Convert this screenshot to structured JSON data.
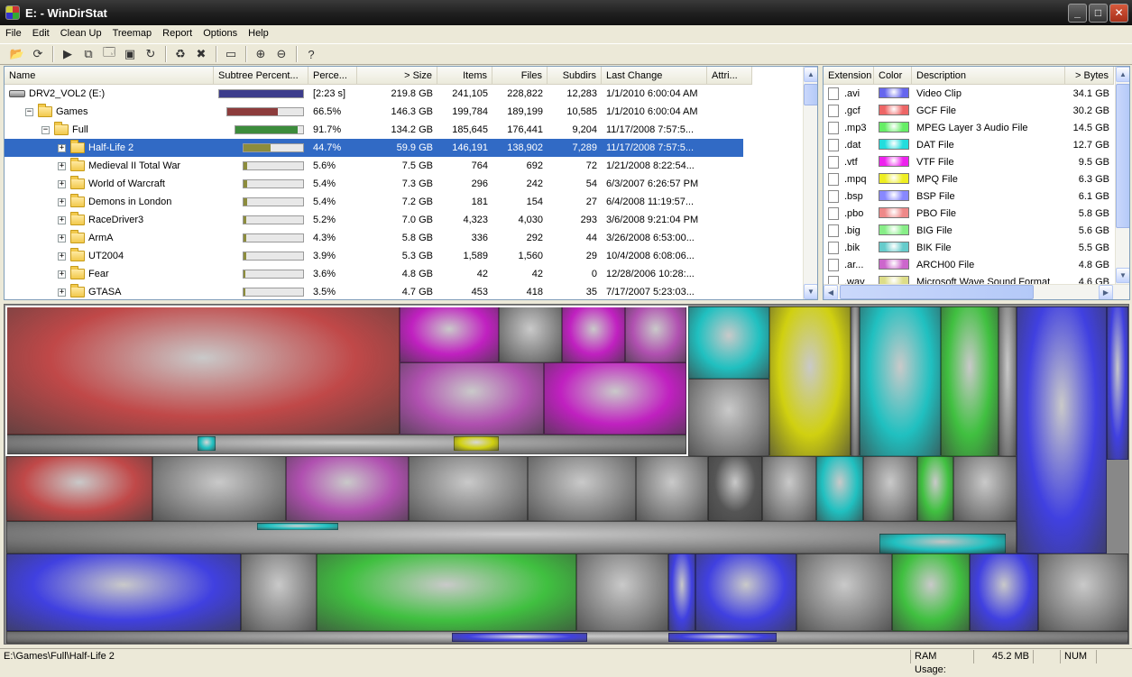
{
  "window": {
    "title": "E: - WinDirStat"
  },
  "menu": [
    "File",
    "Edit",
    "Clean Up",
    "Treemap",
    "Report",
    "Options",
    "Help"
  ],
  "toolbar": [
    {
      "name": "open-icon",
      "glyph": "📂"
    },
    {
      "name": "refresh-icon",
      "glyph": "⟳"
    },
    {
      "sep": true
    },
    {
      "name": "play-icon",
      "glyph": "▶"
    },
    {
      "name": "copy-icon",
      "glyph": "⧉"
    },
    {
      "name": "explorer-icon",
      "glyph": "🗔"
    },
    {
      "name": "command-prompt-icon",
      "glyph": "▣"
    },
    {
      "name": "refresh-green-icon",
      "glyph": "↻"
    },
    {
      "sep": true
    },
    {
      "name": "recycle-icon",
      "glyph": "♻"
    },
    {
      "name": "delete-icon",
      "glyph": "✖"
    },
    {
      "sep": true
    },
    {
      "name": "new-folder-icon",
      "glyph": "▭"
    },
    {
      "sep": true
    },
    {
      "name": "zoom-in-icon",
      "glyph": "⊕"
    },
    {
      "name": "zoom-out-icon",
      "glyph": "⊖"
    },
    {
      "sep": true
    },
    {
      "name": "help-icon",
      "glyph": "?"
    }
  ],
  "dir_columns": [
    "Name",
    "Subtree Percent...",
    "Perce...",
    "> Size",
    "Items",
    "Files",
    "Subdirs",
    "Last Change",
    "Attri..."
  ],
  "dir_rows": [
    {
      "depth": 0,
      "type": "drive",
      "exp": "",
      "name": "DRV2_VOL2 (E:)",
      "bar": 1.0,
      "color": "#3c3c8c",
      "percent": "[2:23 s]",
      "size": "219.8 GB",
      "items": "241,105",
      "files": "228,822",
      "subdirs": "12,283",
      "change": "1/1/2010  6:00:04 AM"
    },
    {
      "depth": 1,
      "type": "folder",
      "exp": "−",
      "name": "Games",
      "bar": 0.665,
      "color": "#8c3c3c",
      "percent": "66.5%",
      "size": "146.3 GB",
      "items": "199,784",
      "files": "189,199",
      "subdirs": "10,585",
      "change": "1/1/2010  6:00:04 AM"
    },
    {
      "depth": 2,
      "type": "folder",
      "exp": "−",
      "name": "Full",
      "bar": 0.917,
      "color": "#3c8c3c",
      "percent": "91.7%",
      "size": "134.2 GB",
      "items": "185,645",
      "files": "176,441",
      "subdirs": "9,204",
      "change": "11/17/2008  7:57:5..."
    },
    {
      "depth": 3,
      "type": "folder",
      "exp": "+",
      "name": "Half-Life 2",
      "bar": 0.447,
      "color": "#8c8c3c",
      "percent": "44.7%",
      "size": "59.9 GB",
      "items": "146,191",
      "files": "138,902",
      "subdirs": "7,289",
      "change": "11/17/2008  7:57:5...",
      "selected": true
    },
    {
      "depth": 3,
      "type": "folder",
      "exp": "+",
      "name": "Medieval II Total War",
      "bar": 0.056,
      "color": "#8c8c3c",
      "percent": "5.6%",
      "size": "7.5 GB",
      "items": "764",
      "files": "692",
      "subdirs": "72",
      "change": "1/21/2008  8:22:54..."
    },
    {
      "depth": 3,
      "type": "folder",
      "exp": "+",
      "name": "World of Warcraft",
      "bar": 0.054,
      "color": "#8c8c3c",
      "percent": "5.4%",
      "size": "7.3 GB",
      "items": "296",
      "files": "242",
      "subdirs": "54",
      "change": "6/3/2007  6:26:57 PM"
    },
    {
      "depth": 3,
      "type": "folder",
      "exp": "+",
      "name": "Demons in London",
      "bar": 0.054,
      "color": "#8c8c3c",
      "percent": "5.4%",
      "size": "7.2 GB",
      "items": "181",
      "files": "154",
      "subdirs": "27",
      "change": "6/4/2008  11:19:57..."
    },
    {
      "depth": 3,
      "type": "folder",
      "exp": "+",
      "name": "RaceDriver3",
      "bar": 0.052,
      "color": "#8c8c3c",
      "percent": "5.2%",
      "size": "7.0 GB",
      "items": "4,323",
      "files": "4,030",
      "subdirs": "293",
      "change": "3/6/2008  9:21:04 PM"
    },
    {
      "depth": 3,
      "type": "folder",
      "exp": "+",
      "name": "ArmA",
      "bar": 0.043,
      "color": "#8c8c3c",
      "percent": "4.3%",
      "size": "5.8 GB",
      "items": "336",
      "files": "292",
      "subdirs": "44",
      "change": "3/26/2008  6:53:00..."
    },
    {
      "depth": 3,
      "type": "folder",
      "exp": "+",
      "name": "UT2004",
      "bar": 0.039,
      "color": "#8c8c3c",
      "percent": "3.9%",
      "size": "5.3 GB",
      "items": "1,589",
      "files": "1,560",
      "subdirs": "29",
      "change": "10/4/2008  6:08:06..."
    },
    {
      "depth": 3,
      "type": "folder",
      "exp": "+",
      "name": "Fear",
      "bar": 0.036,
      "color": "#8c8c3c",
      "percent": "3.6%",
      "size": "4.8 GB",
      "items": "42",
      "files": "42",
      "subdirs": "0",
      "change": "12/28/2006  10:28:..."
    },
    {
      "depth": 3,
      "type": "folder",
      "exp": "+",
      "name": "GTASA",
      "bar": 0.035,
      "color": "#8c8c3c",
      "percent": "3.5%",
      "size": "4.7 GB",
      "items": "453",
      "files": "418",
      "subdirs": "35",
      "change": "7/17/2007  5:23:03..."
    }
  ],
  "ext_columns": [
    "Extension",
    "Color",
    "Description",
    "> Bytes"
  ],
  "ext_rows": [
    {
      "ext": ".avi",
      "color": "#6666ee",
      "desc": "Video Clip",
      "bytes": "34.1 GB"
    },
    {
      "ext": ".gcf",
      "color": "#ee6666",
      "desc": "GCF File",
      "bytes": "30.2 GB"
    },
    {
      "ext": ".mp3",
      "color": "#66ee66",
      "desc": "MPEG Layer 3 Audio File",
      "bytes": "14.5 GB"
    },
    {
      "ext": ".dat",
      "color": "#22dddd",
      "desc": "DAT File",
      "bytes": "12.7 GB"
    },
    {
      "ext": ".vtf",
      "color": "#ee22ee",
      "desc": "VTF File",
      "bytes": "9.5 GB"
    },
    {
      "ext": ".mpq",
      "color": "#eeee22",
      "desc": "MPQ File",
      "bytes": "6.3 GB"
    },
    {
      "ext": ".bsp",
      "color": "#8888ff",
      "desc": "BSP File",
      "bytes": "6.1 GB"
    },
    {
      "ext": ".pbo",
      "color": "#ee8888",
      "desc": "PBO File",
      "bytes": "5.8 GB"
    },
    {
      "ext": ".big",
      "color": "#88ee88",
      "desc": "BIG File",
      "bytes": "5.6 GB"
    },
    {
      "ext": ".bik",
      "color": "#66cccc",
      "desc": "BIK File",
      "bytes": "5.5 GB"
    },
    {
      "ext": ".ar...",
      "color": "#cc66cc",
      "desc": "ARCH00 File",
      "bytes": "4.8 GB"
    },
    {
      "ext": ".wav",
      "color": "#dddd88",
      "desc": "Microsoft Wave Sound Format",
      "bytes": "4.6 GB"
    }
  ],
  "treemap_colors": {
    "red": "#c04848",
    "magenta": "#c020c0",
    "purple": "#b050b0",
    "gray": "#8a8a8a",
    "cyan": "#20c0c0",
    "yellow": "#d0d010",
    "green": "#40c040",
    "blue": "#4040e0",
    "dark": "#555555"
  },
  "status": {
    "path": "E:\\Games\\Full\\Half-Life 2",
    "ram_label": "RAM Usage:",
    "ram_value": "45.2 MB",
    "num": "NUM"
  }
}
